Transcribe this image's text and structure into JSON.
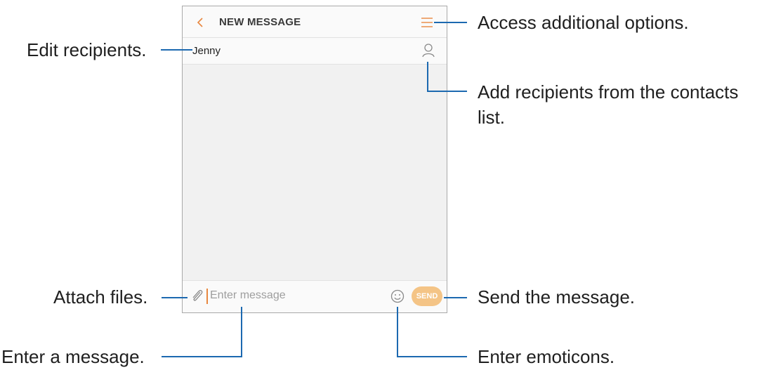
{
  "app": {
    "title": "NEW MESSAGE",
    "recipient": "Jenny",
    "message_placeholder": "Enter message",
    "send_label": "SEND",
    "accent_color": "#e8873f",
    "send_color": "#f4c486"
  },
  "icons": [
    "chevron-left-icon",
    "menu-icon",
    "person-icon",
    "paperclip-icon",
    "smiley-icon"
  ],
  "callouts": {
    "edit_recipients": "Edit recipients.",
    "attach_files": "Attach files.",
    "enter_message": "Enter a message.",
    "access_options": "Access additional options.",
    "add_recipients_line1": "Add recipients from the contacts",
    "add_recipients_line2": "list.",
    "send_message": "Send the message.",
    "enter_emoticons": "Enter emoticons."
  },
  "colors": {
    "callout_line": "#1c69b0"
  }
}
